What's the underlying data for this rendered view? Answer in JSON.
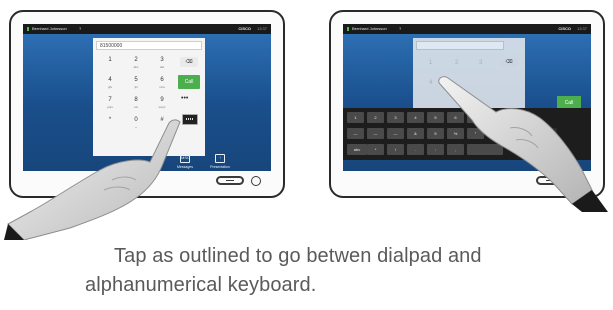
{
  "left_device": {
    "topbar": {
      "user": "Bernhard Johnsson",
      "help": "?",
      "brand": "CISCO",
      "time": "13:37"
    },
    "number_field": "81500000",
    "keys": [
      {
        "digit": "1",
        "letters": ""
      },
      {
        "digit": "2",
        "letters": "abc"
      },
      {
        "digit": "3",
        "letters": "def"
      },
      {
        "digit": "4",
        "letters": "ghi"
      },
      {
        "digit": "5",
        "letters": "jkl"
      },
      {
        "digit": "6",
        "letters": "mno"
      },
      {
        "digit": "7",
        "letters": "pqrs"
      },
      {
        "digit": "8",
        "letters": "tuv"
      },
      {
        "digit": "9",
        "letters": "wxyz"
      },
      {
        "digit": "*",
        "letters": ""
      },
      {
        "digit": "0",
        "letters": "+"
      },
      {
        "digit": "#",
        "letters": ""
      }
    ],
    "call_label": "Call",
    "more_label": "•••",
    "bottom_items": [
      "Messages",
      "Presentation"
    ],
    "message_badge": "MSG"
  },
  "right_device": {
    "topbar": {
      "user": "Bernhard Johnsson",
      "help": "?",
      "brand": "CISCO",
      "time": "13:37"
    },
    "faint_digits": [
      "1",
      "2",
      "3",
      "4"
    ],
    "kbd_row1": [
      "1",
      "2",
      "3",
      "4",
      "5",
      "6",
      "7",
      "8",
      "9"
    ],
    "kbd_row2": [
      "—",
      "—",
      "—",
      "&",
      "5",
      "%",
      "°"
    ],
    "kbd_row3": [
      "abc",
      "*",
      "/",
      ".",
      ":",
      ","
    ],
    "call_label": "Call"
  },
  "caption": {
    "line1": "Tap as outlined to go betwen dialpad and",
    "line2": "alphanumerical keyboard."
  }
}
